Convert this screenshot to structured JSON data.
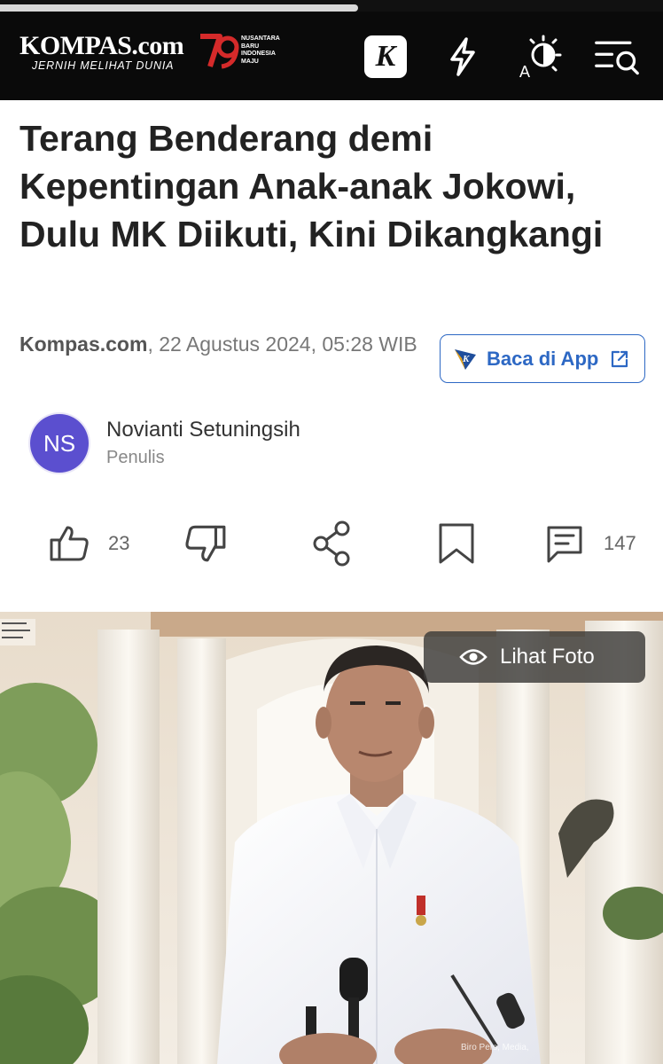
{
  "header": {
    "logo_word": "KOMPAS.com",
    "logo_tagline": "JERNIH MELIHAT DUNIA",
    "anniversary_text": "NUSANTARA\nBARU\nINDONESIA\nMAJU",
    "k_icon_letter": "K",
    "theme_icon_letter": "A"
  },
  "reading_progress": 0.54,
  "article": {
    "title": "Terang Benderang demi Kepentingan Anak-anak Jokowi, Dulu MK Diikuti, Kini Dikangkangi",
    "source": "Kompas.com",
    "datetime": ", 22 Agustus 2024, 05:28 WIB",
    "app_button_label": "Baca di App",
    "author": {
      "initials": "NS",
      "name": "Novianti Setuningsih",
      "role": "Penulis"
    }
  },
  "actions": {
    "like_count": "23",
    "comment_count": "147"
  },
  "photo": {
    "view_button_label": "Lihat Foto",
    "watermark_text": "Biro Pers, Media,"
  },
  "colors": {
    "header_bg": "#0a0a0a",
    "accent_blue": "#2d68c4",
    "avatar_purple": "#5b4fcf",
    "logo_red": "#d42a2a"
  },
  "icons": [
    "k-app-icon",
    "bolt-icon",
    "theme-toggle-icon",
    "menu-search-icon",
    "thumbs-up-icon",
    "thumbs-down-icon",
    "share-icon",
    "bookmark-icon",
    "comment-icon",
    "eye-icon",
    "external-link-icon"
  ]
}
